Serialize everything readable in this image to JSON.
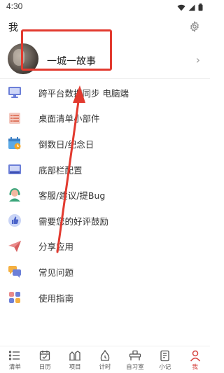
{
  "status_bar": {
    "time": "4:30"
  },
  "header": {
    "title": "我"
  },
  "profile": {
    "name": "一城一故事"
  },
  "menu": {
    "items": [
      {
        "label": "跨平台数据同步 电脑端",
        "icon": "monitor-sync-icon"
      },
      {
        "label": "桌面清单小部件",
        "icon": "widget-list-icon"
      },
      {
        "label": "倒数日/纪念日",
        "icon": "calendar-countdown-icon"
      },
      {
        "label": "底部栏配置",
        "icon": "bottom-bar-icon"
      },
      {
        "label": "客服/建议/提Bug",
        "icon": "support-agent-icon"
      },
      {
        "label": "需要您的好评鼓励",
        "icon": "thumbs-up-icon"
      },
      {
        "label": "分享应用",
        "icon": "paper-plane-icon"
      },
      {
        "label": "常见问题",
        "icon": "chat-bubbles-icon"
      },
      {
        "label": "使用指南",
        "icon": "guide-grid-icon"
      }
    ]
  },
  "tabbar": {
    "tabs": [
      {
        "label": "清单",
        "icon": "list-icon"
      },
      {
        "label": "日历",
        "icon": "calendar-icon"
      },
      {
        "label": "项目",
        "icon": "project-icon"
      },
      {
        "label": "计时",
        "icon": "timer-icon"
      },
      {
        "label": "自习室",
        "icon": "study-room-icon"
      },
      {
        "label": "小记",
        "icon": "notes-icon"
      },
      {
        "label": "我",
        "icon": "profile-icon"
      }
    ],
    "active_index": 6
  },
  "colors": {
    "accent": "#d64541",
    "annotation": "#e23a2f"
  }
}
